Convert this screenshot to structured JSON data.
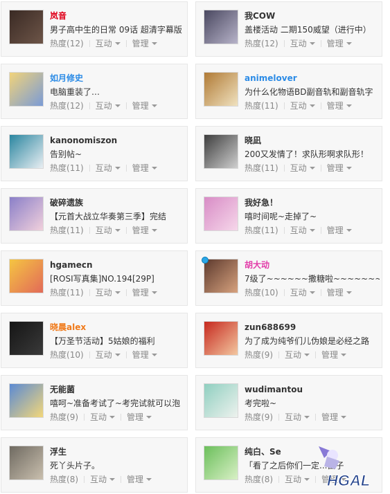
{
  "labels": {
    "heat_prefix": "热度",
    "interact": "互动",
    "manage": "管理"
  },
  "cards": [
    {
      "name": "岚音",
      "name_color": "#e0001a",
      "desc": "男子高中生的日常 09话 超清字幕版",
      "heat": "(12)",
      "avatar_colors": [
        "#3a2a24",
        "#6d5548"
      ],
      "online": false
    },
    {
      "name": "我COW",
      "name_color": "#333333",
      "desc": "盖楼活动 二期150威望（进行中）",
      "heat": "(12)",
      "avatar_colors": [
        "#4a4860",
        "#b7b3c9"
      ],
      "online": false
    },
    {
      "name": "如月修史",
      "name_color": "#2b8be6",
      "desc": "电脑重装了…",
      "heat": "(12)",
      "avatar_colors": [
        "#f1d37a",
        "#7a9bd6"
      ],
      "online": false
    },
    {
      "name": "animelover",
      "name_color": "#2b8be6",
      "desc": "为什么化物语BD副音轨和副音轨字",
      "heat": "(11)",
      "avatar_colors": [
        "#b07a35",
        "#f0e2c0"
      ],
      "online": false
    },
    {
      "name": "kanonomiszon",
      "name_color": "#333333",
      "desc": "告别帖~",
      "heat": "(11)",
      "avatar_colors": [
        "#2a86a0",
        "#e9eef2"
      ],
      "online": false
    },
    {
      "name": "晓凪",
      "name_color": "#333333",
      "desc": "200又发情了！求队形啊求队形！",
      "heat": "(11)",
      "avatar_colors": [
        "#3e3e3e",
        "#cfcfcf"
      ],
      "online": false
    },
    {
      "name": "破碎遗族",
      "name_color": "#333333",
      "desc": "【元首大战立华奏第三季】完结",
      "heat": "(11)",
      "avatar_colors": [
        "#8a7fc8",
        "#f1d0dc"
      ],
      "online": false
    },
    {
      "name": "我好急！",
      "name_color": "#333333",
      "desc": "嘻时间呢~走掉了~",
      "heat": "(11)",
      "avatar_colors": [
        "#d88cc6",
        "#f6d7ea"
      ],
      "online": false
    },
    {
      "name": "hgamecn",
      "name_color": "#333333",
      "desc": "[ROSI写真集]NO.194[29P]",
      "heat": "(11)",
      "avatar_colors": [
        "#f5c542",
        "#e26a58"
      ],
      "online": false
    },
    {
      "name": "胡大动",
      "name_color": "#e23aa8",
      "desc": "7级了~~~~~~撒糖啦~~~~~~~",
      "heat": "(10)",
      "avatar_colors": [
        "#5d3a2e",
        "#d7a27e"
      ],
      "online": true
    },
    {
      "name": "晓晨alex",
      "name_color": "#f07a1a",
      "desc": "【万圣节活动】5姑娘的福利",
      "heat": "(10)",
      "avatar_colors": [
        "#151515",
        "#3a3a3a"
      ],
      "online": false
    },
    {
      "name": "zun688699",
      "name_color": "#333333",
      "desc": "为了成为纯爷们儿伪娘是必经之路",
      "heat": "(9)",
      "avatar_colors": [
        "#c6291f",
        "#f3c7a0"
      ],
      "online": false
    },
    {
      "name": "无能菌",
      "name_color": "#333333",
      "desc": "嘻呵~准备考试了~考完试就可以泡",
      "heat": "(9)",
      "avatar_colors": [
        "#5b8ad3",
        "#f3d77a"
      ],
      "online": false
    },
    {
      "name": "wudimantou",
      "name_color": "#333333",
      "desc": "考完啦~",
      "heat": "(9)",
      "avatar_colors": [
        "#8fcfc0",
        "#eef2ee"
      ],
      "online": false
    },
    {
      "name": "浮生",
      "name_color": "#333333",
      "desc": "死丫头片子。",
      "heat": "(8)",
      "avatar_colors": [
        "#6f6a61",
        "#c9bfae"
      ],
      "online": false
    },
    {
      "name": "纯白、Se",
      "name_color": "#333333",
      "desc": "「看了之后你们一定...笛子",
      "heat": "(8)",
      "avatar_colors": [
        "#6bbf5b",
        "#d9f0c6"
      ],
      "online": false
    }
  ],
  "watermark_text": "HGAL"
}
